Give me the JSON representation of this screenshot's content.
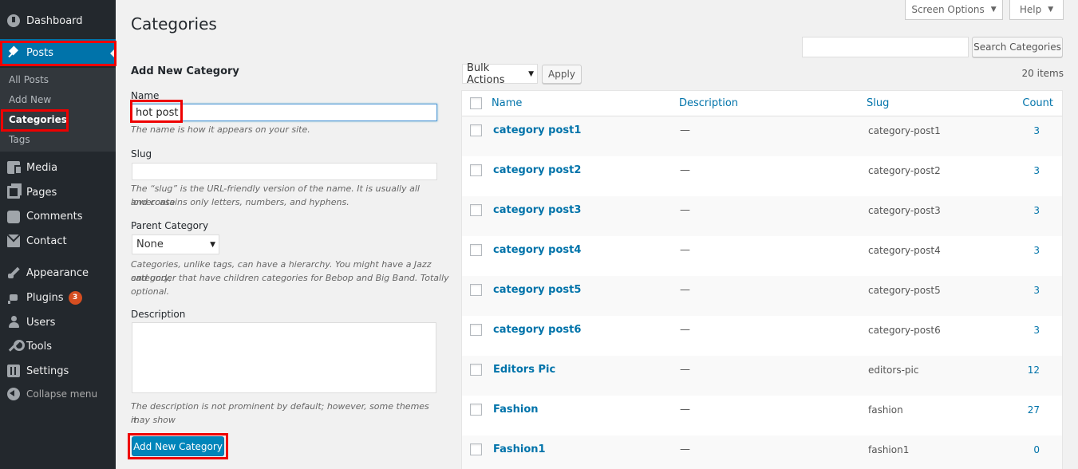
{
  "sidebar": {
    "items": [
      {
        "label": "Dashboard",
        "icon": "dashboard-icon"
      },
      {
        "label": "Posts",
        "icon": "pin-icon"
      },
      {
        "label": "Media",
        "icon": "media-icon"
      },
      {
        "label": "Pages",
        "icon": "pages-icon"
      },
      {
        "label": "Comments",
        "icon": "comments-icon"
      },
      {
        "label": "Contact",
        "icon": "envelope-icon"
      },
      {
        "label": "Appearance",
        "icon": "brush-icon"
      },
      {
        "label": "Plugins",
        "icon": "plugin-icon",
        "badge": "3"
      },
      {
        "label": "Users",
        "icon": "users-icon"
      },
      {
        "label": "Tools",
        "icon": "wrench-icon"
      },
      {
        "label": "Settings",
        "icon": "settings-icon"
      }
    ],
    "collapse_label": "Collapse menu",
    "posts_submenu": [
      "All Posts",
      "Add New",
      "Categories",
      "Tags"
    ]
  },
  "header": {
    "title": "Categories",
    "screen_options": "Screen Options",
    "help": "Help"
  },
  "search": {
    "value": "",
    "button": "Search Categories"
  },
  "form": {
    "heading": "Add New Category",
    "name_label": "Name",
    "name_value": "hot post",
    "name_help": "The name is how it appears on your site.",
    "slug_label": "Slug",
    "slug_value": "",
    "slug_help_1": "The “slug” is the URL-friendly version of the name. It is usually all lowercase",
    "slug_help_2": "and contains only letters, numbers, and hyphens.",
    "parent_label": "Parent Category",
    "parent_value": "None",
    "parent_help_1": "Categories, unlike tags, can have a hierarchy. You might have a Jazz category,",
    "parent_help_2": "and under that have children categories for Bebop and Big Band. Totally",
    "parent_help_3": "optional.",
    "desc_label": "Description",
    "desc_help_1": "The description is not prominent by default; however, some themes may show",
    "desc_help_2": "it.",
    "submit": "Add New Category"
  },
  "table": {
    "bulk_actions": "Bulk Actions",
    "apply": "Apply",
    "items_count": "20 items",
    "columns": {
      "name": "Name",
      "description": "Description",
      "slug": "Slug",
      "count": "Count"
    },
    "rows": [
      {
        "name": "category post1",
        "description": "—",
        "slug": "category-post1",
        "count": "3"
      },
      {
        "name": "category post2",
        "description": "—",
        "slug": "category-post2",
        "count": "3"
      },
      {
        "name": "category post3",
        "description": "—",
        "slug": "category-post3",
        "count": "3"
      },
      {
        "name": "category post4",
        "description": "—",
        "slug": "category-post4",
        "count": "3"
      },
      {
        "name": "category post5",
        "description": "—",
        "slug": "category-post5",
        "count": "3"
      },
      {
        "name": "category post6",
        "description": "—",
        "slug": "category-post6",
        "count": "3"
      },
      {
        "name": "Editors Pic",
        "description": "—",
        "slug": "editors-pic",
        "count": "12"
      },
      {
        "name": "Fashion",
        "description": "—",
        "slug": "fashion",
        "count": "27"
      },
      {
        "name": "Fashion1",
        "description": "—",
        "slug": "fashion1",
        "count": "0"
      }
    ]
  },
  "colors": {
    "sidebar_bg": "#23282d",
    "accent": "#0073aa",
    "highlight_outline": "#e00000",
    "primary_button": "#0085ba",
    "badge": "#d54e21"
  }
}
